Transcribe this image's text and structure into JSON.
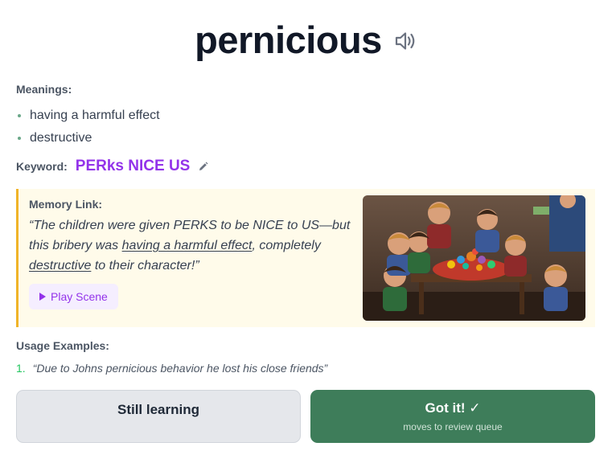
{
  "word": "pernicious",
  "meanings_label": "Meanings:",
  "meanings": [
    "having a harmful effect",
    "destructive"
  ],
  "keyword_label": "Keyword:",
  "keyword": "PERks NICE US",
  "memory": {
    "label": "Memory Link:",
    "part1": "“The children were given PERKS to be NICE to US—but this bribery was ",
    "underline1": "having a harmful effect",
    "part2": ", completely ",
    "underline2": "destructive",
    "part3": " to their character!”",
    "play_label": "Play Scene"
  },
  "usage_label": "Usage Examples:",
  "examples": [
    {
      "num": "1.",
      "text": "“Due to Johns pernicious behavior he lost his close friends”"
    }
  ],
  "buttons": {
    "still_learning": "Still learning",
    "got_it": "Got it! ✓",
    "got_it_sub": "moves to review queue"
  },
  "colors": {
    "keyword": "#9333ea",
    "memory_bg": "#fffbea",
    "memory_border": "#f0b429",
    "got_it_bg": "#3e7d5a"
  },
  "icons": {
    "speaker": "speaker-icon",
    "edit": "pencil-icon",
    "play": "play-icon"
  }
}
